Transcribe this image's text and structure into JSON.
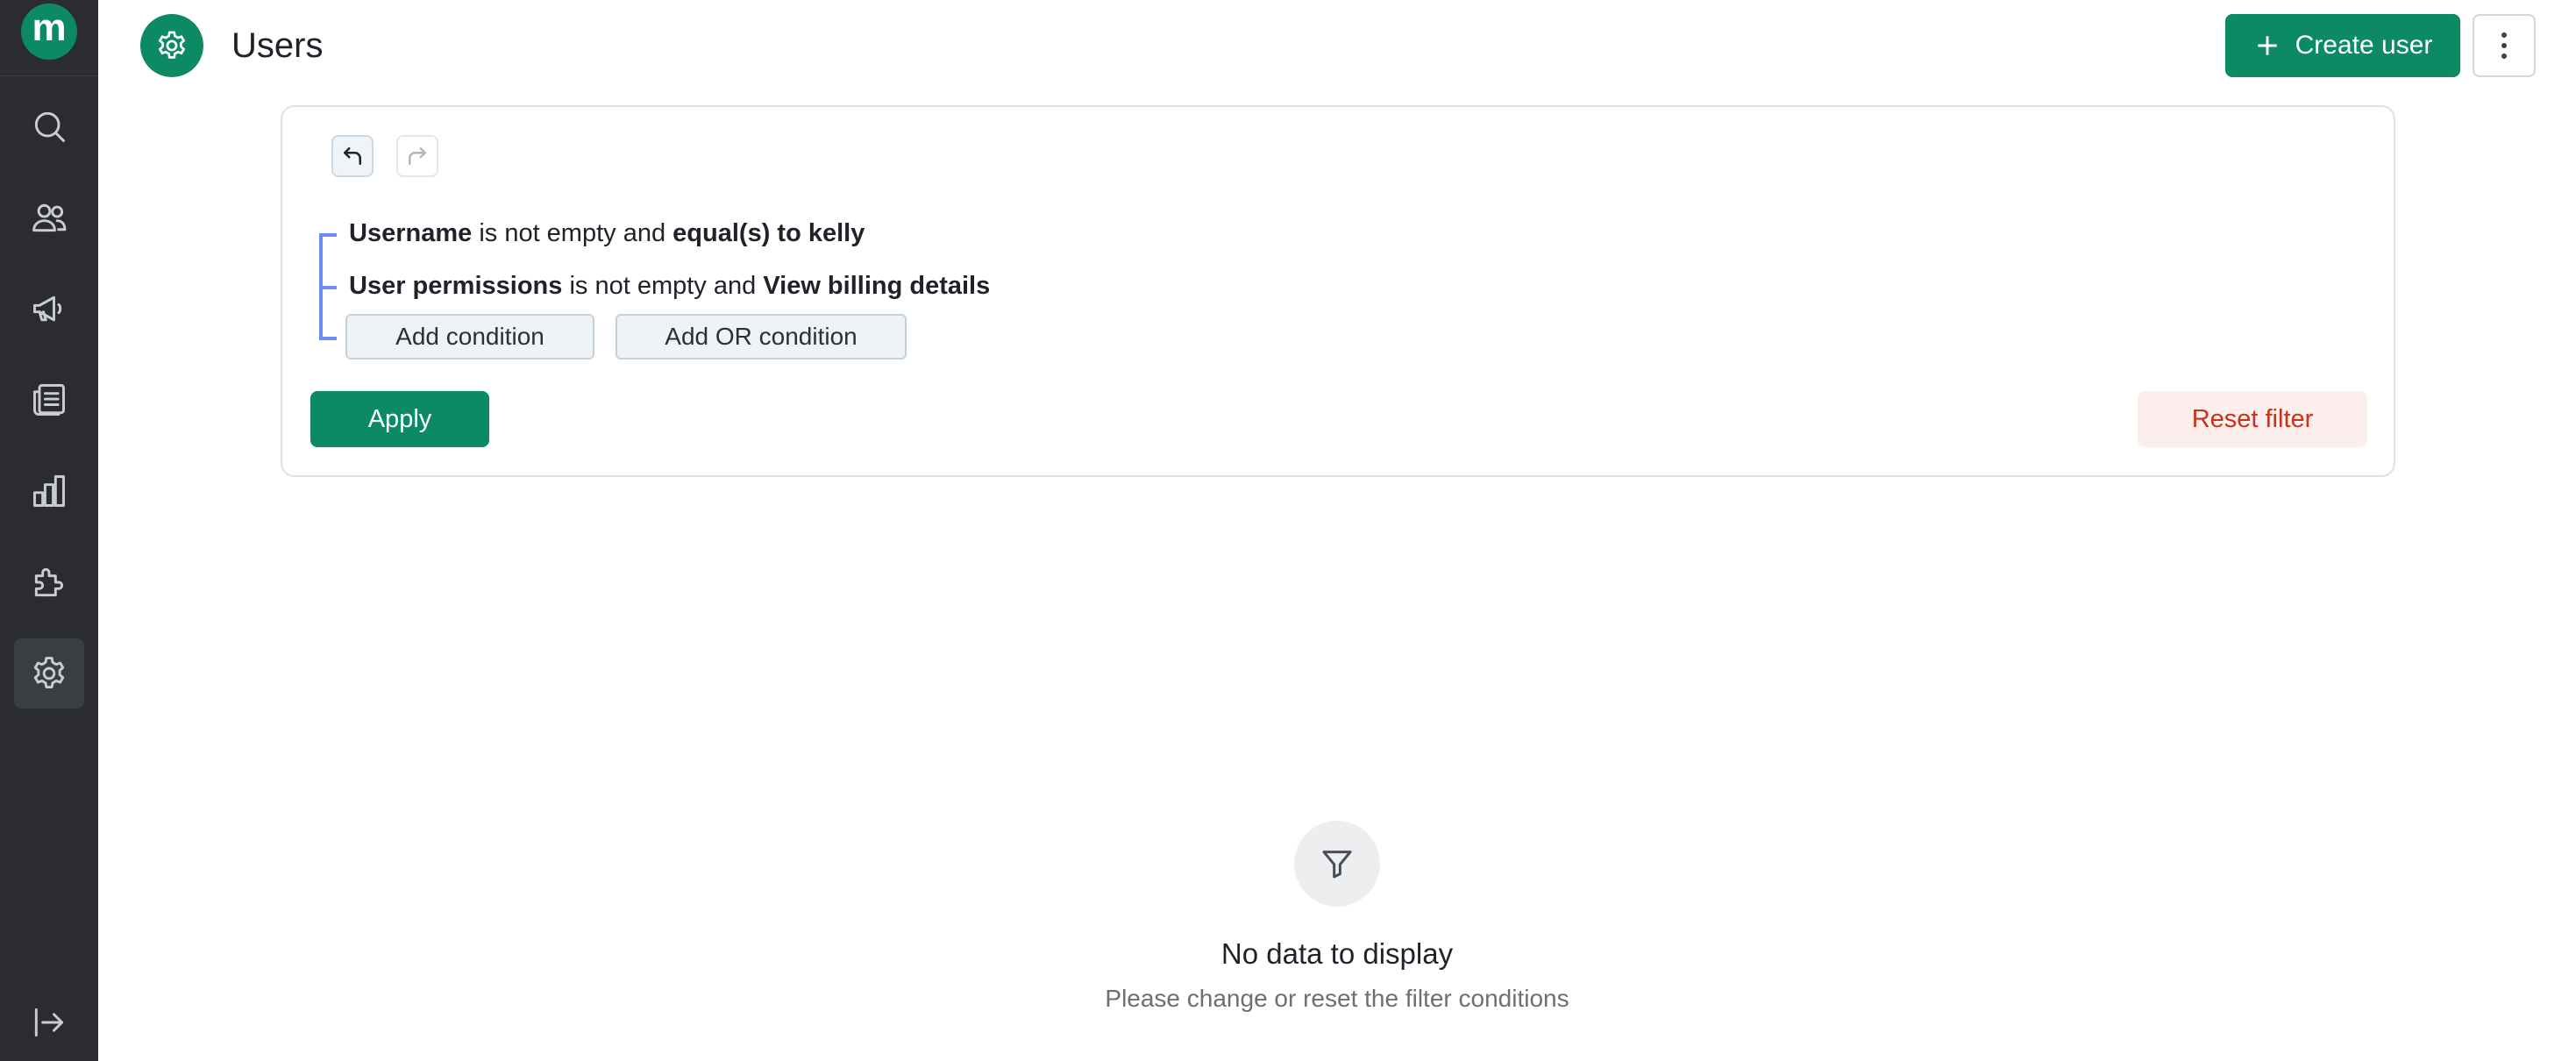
{
  "sidebar": {
    "logo_letter": "m",
    "items": [
      {
        "icon": "search-icon"
      },
      {
        "icon": "users-icon"
      },
      {
        "icon": "megaphone-icon"
      },
      {
        "icon": "articles-icon"
      },
      {
        "icon": "reports-icon"
      },
      {
        "icon": "integrations-icon"
      },
      {
        "icon": "settings-icon",
        "active": true
      }
    ],
    "footer_icon": "expand-sidebar-icon"
  },
  "header": {
    "icon": "settings-icon",
    "title": "Users",
    "create_label": "Create user",
    "more_icon": "more-vertical-icon"
  },
  "filter": {
    "undo_icon": "undo-icon",
    "redo_icon": "redo-icon",
    "conditions": [
      {
        "field": "Username",
        "operator": "is not empty and",
        "value": "equal(s) to kelly"
      },
      {
        "field": "User permissions",
        "operator": "is not empty and",
        "value": "View billing details"
      }
    ],
    "add_condition_label": "Add condition",
    "add_or_condition_label": "Add OR condition",
    "apply_label": "Apply",
    "reset_label": "Reset filter"
  },
  "empty_state": {
    "icon": "filter-icon",
    "title": "No data to display",
    "subtitle": "Please change or reset the filter conditions"
  },
  "colors": {
    "brand": "#0b8a64",
    "sidebar_bg": "#2a2c30",
    "tree_line": "#6d8cf2",
    "reset_text": "#c7321a",
    "reset_bg": "#fdeeee"
  }
}
